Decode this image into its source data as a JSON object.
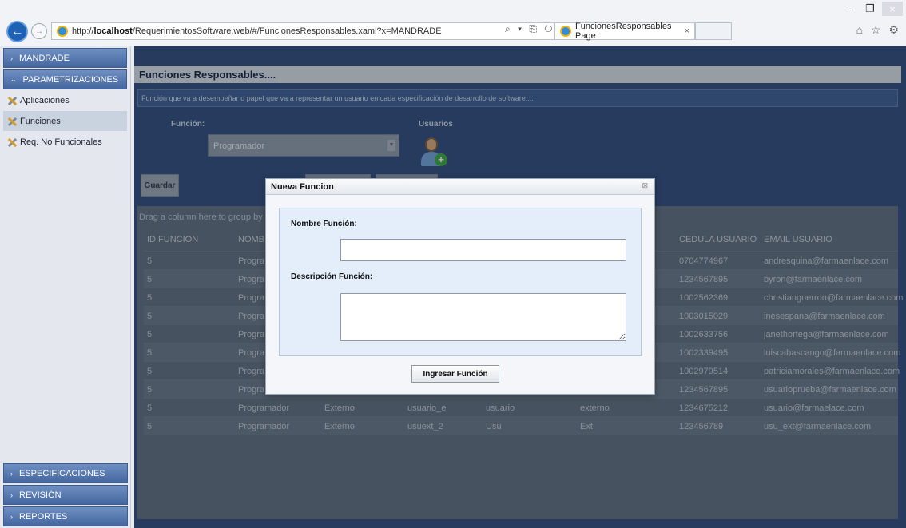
{
  "browser": {
    "url_prefix": "http://",
    "url_host": "localhost",
    "url_path": "/RequerimientosSoftware.web/#/FuncionesResponsables.xaml?x=MANDRADE",
    "tab_title": "FuncionesResponsables Page",
    "tab_close": "×",
    "minimize": "–",
    "maximize": "❐",
    "close": "×",
    "addr_tools": "⌕ ▾ ⎘ ↻",
    "fav_tools": "⌂ ☆ ⚙"
  },
  "sidebar": {
    "user": "MANDRADE",
    "section_param": "PARAMETRIZACIONES",
    "items": [
      {
        "label": "Aplicaciones"
      },
      {
        "label": "Funciones"
      },
      {
        "label": "Req. No Funcionales"
      }
    ],
    "bottom": [
      {
        "label": "ESPECIFICACIONES"
      },
      {
        "label": "REVISIÓN"
      },
      {
        "label": "REPORTES"
      }
    ]
  },
  "main": {
    "title": "Funciones Responsables....",
    "description": "Función que va a desempeñar o papel que va a representar un usuario en cada especificación de desarrollo de software....",
    "funcion_label": "Función:",
    "usuarios_label": "Usuarios",
    "funcion_value": "Programador",
    "guardar": "Guardar",
    "group_hint": "Drag a column here to group by t",
    "columns": [
      "ID FUNCION",
      "NOMB",
      "CEDULA USUARIO",
      "EMAIL USUARIO"
    ],
    "rows": [
      {
        "id": "5",
        "nombre": "Progra",
        "c3": "",
        "c4": "",
        "c5": "",
        "c6": "",
        "cedula": "0704774967",
        "email": "andresquina@farmaenlace.com"
      },
      {
        "id": "5",
        "nombre": "Progra",
        "c3": "",
        "c4": "",
        "c5": "",
        "c6": "",
        "cedula": "1234567895",
        "email": "byron@farmaenlace.com"
      },
      {
        "id": "5",
        "nombre": "Progra",
        "c3": "",
        "c4": "",
        "c5": "",
        "c6": "E",
        "cedula": "1002562369",
        "email": "christianguerron@farmaenlace.com"
      },
      {
        "id": "5",
        "nombre": "Progra",
        "c3": "",
        "c4": "",
        "c5": "",
        "c6": "",
        "cedula": "1003015029",
        "email": "inesespana@farmaenlace.com"
      },
      {
        "id": "5",
        "nombre": "Progra",
        "c3": "",
        "c4": "",
        "c5": "",
        "c6": "",
        "cedula": "1002633756",
        "email": "janethortega@farmaenlace.com"
      },
      {
        "id": "5",
        "nombre": "Progra",
        "c3": "",
        "c4": "",
        "c5": "",
        "c6": "NGO",
        "cedula": "1002339495",
        "email": "luiscabascango@farmaenlace.com"
      },
      {
        "id": "5",
        "nombre": "Progra",
        "c3": "",
        "c4": "",
        "c5": "",
        "c6": "DO",
        "cedula": "1002979514",
        "email": "patriciamorales@farmaenlace.com"
      },
      {
        "id": "5",
        "nombre": "Progra",
        "c3": "",
        "c4": "",
        "c5": "",
        "c6": "",
        "cedula": "1234567895",
        "email": "usuarioprueba@farmaenlace.com"
      },
      {
        "id": "5",
        "nombre": "Programador",
        "c3": "Externo",
        "c4": "usuario_e",
        "c5": "usuario",
        "c6": "externo",
        "cedula": "1234675212",
        "email": "usuario@farmaelace.com"
      },
      {
        "id": "5",
        "nombre": "Programador",
        "c3": "Externo",
        "c4": "usuext_2",
        "c5": "Usu",
        "c6": "Ext",
        "cedula": "123456789",
        "email": "usu_ext@farmaenlace.com"
      }
    ]
  },
  "modal": {
    "title": "Nueva Funcion",
    "close": "⊠",
    "nombre_label": "Nombre Función:",
    "desc_label": "Descripción Función:",
    "nombre_value": "",
    "desc_value": "",
    "submit": "Ingresar Función"
  }
}
